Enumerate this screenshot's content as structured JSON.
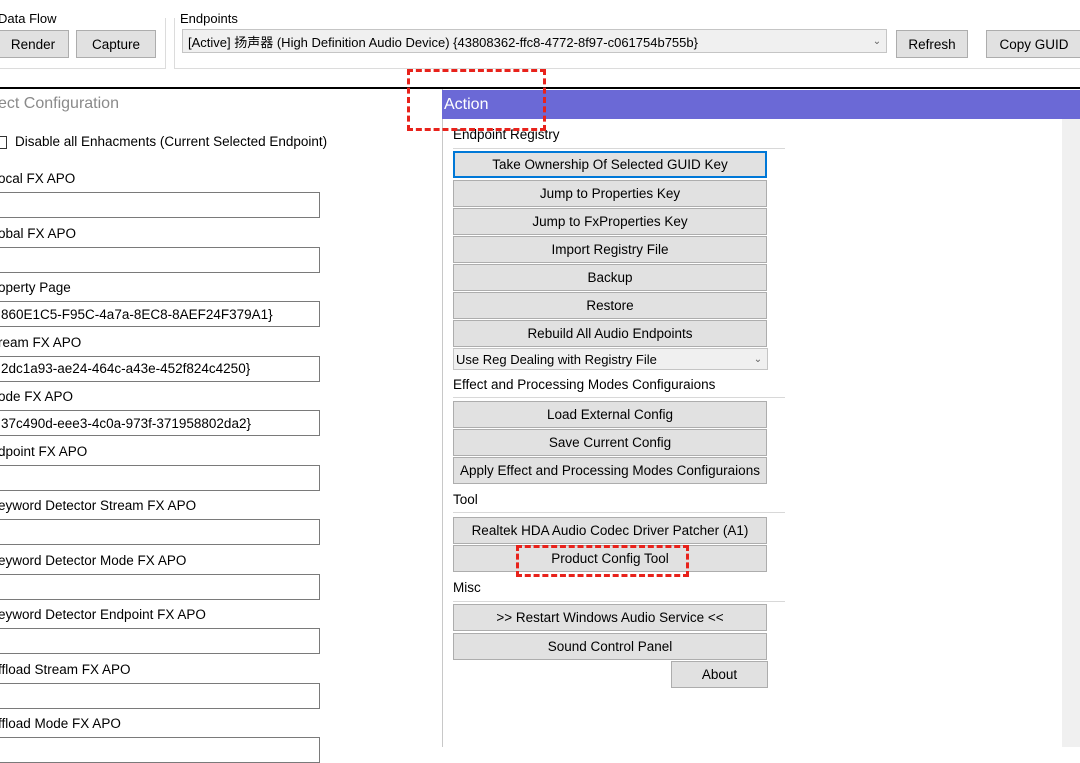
{
  "top": {
    "data_flow_label": "Data Flow",
    "render_label": "Render",
    "capture_label": "Capture",
    "endpoints_label": "Endpoints",
    "endpoint_selected": "[Active] 扬声器 (High Definition Audio Device) {43808362-ffc8-4772-8f97-c061754b755b}",
    "refresh_label": "Refresh",
    "copy_guid_label": "Copy GUID"
  },
  "left": {
    "header": "ect Configuration",
    "disable_label": "Disable all Enhacments (Current Selected Endpoint)",
    "fields": [
      {
        "label": "ocal FX APO",
        "value": ""
      },
      {
        "label": "obal FX APO",
        "value": ""
      },
      {
        "label": "operty Page",
        "value": "860E1C5-F95C-4a7a-8EC8-8AEF24F379A1}"
      },
      {
        "label": "ream FX APO",
        "value": "2dc1a93-ae24-464c-a43e-452f824c4250}"
      },
      {
        "label": "ode FX APO",
        "value": "37c490d-eee3-4c0a-973f-371958802da2}"
      },
      {
        "label": "dpoint FX APO",
        "value": ""
      },
      {
        "label": "eyword Detector Stream FX APO",
        "value": ""
      },
      {
        "label": "eyword Detector Mode FX APO",
        "value": ""
      },
      {
        "label": "eyword Detector Endpoint FX APO",
        "value": ""
      },
      {
        "label": "ffload Stream FX APO",
        "value": ""
      },
      {
        "label": "ffload Mode FX APO",
        "value": ""
      }
    ]
  },
  "action": {
    "header": "Action",
    "endpoint_registry_title": "Endpoint Registry",
    "take_ownership": "Take Ownership Of Selected GUID Key",
    "jump_properties": "Jump to Properties Key",
    "jump_fxproperties": "Jump to FxProperties Key",
    "import_registry": "Import Registry File",
    "backup": "Backup",
    "restore": "Restore",
    "rebuild": "Rebuild All Audio Endpoints",
    "reg_dealing": "Use Reg Dealing with Registry File",
    "effect_title": "Effect and Processing Modes Configuraions",
    "load_config": "Load External Config",
    "save_config": "Save Current Config",
    "apply_config": "Apply Effect and Processing Modes Configuraions",
    "tool_title": "Tool",
    "realtek_patcher": "Realtek HDA Audio Codec Driver Patcher (A1)",
    "product_config": "Product Config Tool",
    "misc_title": "Misc",
    "restart_audio": ">> Restart Windows Audio Service <<",
    "sound_panel": "Sound Control Panel",
    "about": "About"
  },
  "colors": {
    "action_header": "#6b69d6",
    "highlight": "#e8221b",
    "button_bg": "#e1e1e1"
  }
}
